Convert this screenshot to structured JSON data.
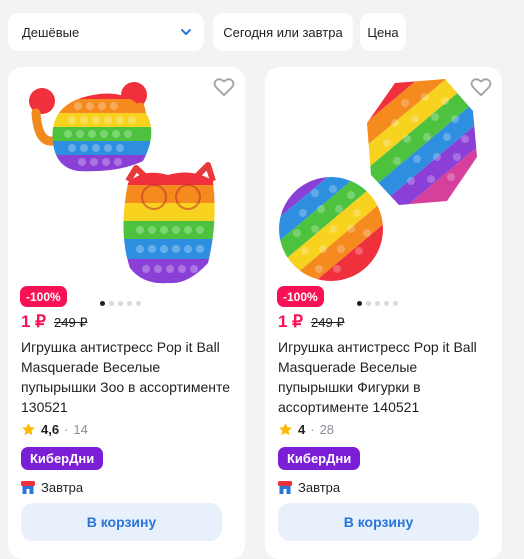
{
  "filters": {
    "sort_label": "Дешёвые",
    "delivery_label": "Сегодня или завтра",
    "price_label": "Цена"
  },
  "products": [
    {
      "discount": "-100%",
      "price_now": "1 ₽",
      "price_old": "249 ₽",
      "title": "Игрушка антистресс Pop it Ball Masquerade Веселые пупырышки Зоо в ассортименте 130521",
      "rating": "4,6",
      "reviews": "14",
      "badge": "КиберДни",
      "delivery": "Завтра",
      "cart_label": "В корзину",
      "image_icon": "pop-it-crab-owl-image",
      "gallery_active": 1,
      "gallery_total": 5
    },
    {
      "discount": "-100%",
      "price_now": "1 ₽",
      "price_old": "249 ₽",
      "title": "Игрушка антистресс Pop it Ball Masquerade Веселые пупырышки Фигурки в ассортименте 140521",
      "rating": "4",
      "reviews": "28",
      "badge": "КиберДни",
      "delivery": "Завтра",
      "cart_label": "В корзину",
      "image_icon": "pop-it-octagon-circle-image",
      "gallery_active": 1,
      "gallery_total": 5
    }
  ],
  "colors": {
    "accent_blue": "#2a75d9",
    "discount_red": "#f91155",
    "badge_purple": "#7b1fd6",
    "star_yellow": "#ffb800"
  }
}
